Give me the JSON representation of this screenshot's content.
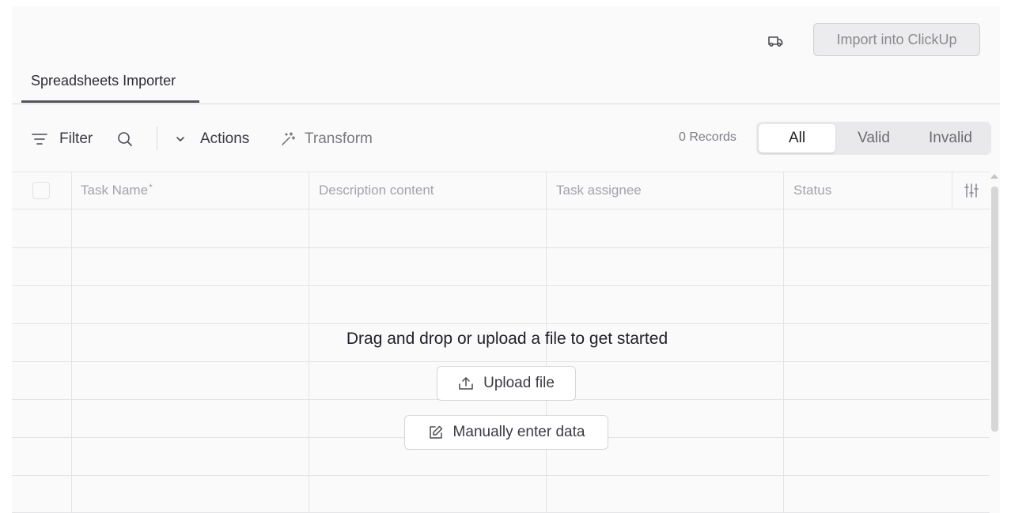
{
  "header": {
    "help_icon": "truck-icon",
    "import_label": "Import into ClickUp"
  },
  "tabs": [
    {
      "label": "Spreadsheets Importer",
      "active": true
    }
  ],
  "toolbar": {
    "filter_label": "Filter",
    "filter_icon": "filter-lines-icon",
    "search_icon": "search-icon",
    "actions_label": "Actions",
    "actions_icon": "chevron-down-icon",
    "transform_label": "Transform",
    "transform_icon": "magic-wand-icon",
    "records_text": "0 Records",
    "segments": [
      {
        "label": "All",
        "active": true
      },
      {
        "label": "Valid",
        "active": false
      },
      {
        "label": "Invalid",
        "active": false
      }
    ]
  },
  "table": {
    "columns": [
      {
        "label": "Task Name",
        "required_mark": "*"
      },
      {
        "label": "Description content"
      },
      {
        "label": "Task assignee"
      },
      {
        "label": "Status"
      }
    ],
    "settings_icon": "sliders-icon"
  },
  "empty_state": {
    "title": "Drag and drop or upload a file to get started",
    "upload_label": "Upload file",
    "upload_icon": "upload-icon",
    "manual_label": "Manually enter data",
    "manual_icon": "edit-icon"
  },
  "colors": {
    "background": "#fafafa",
    "active_tab_underline": "#52525b",
    "text": "#2b2b33"
  }
}
